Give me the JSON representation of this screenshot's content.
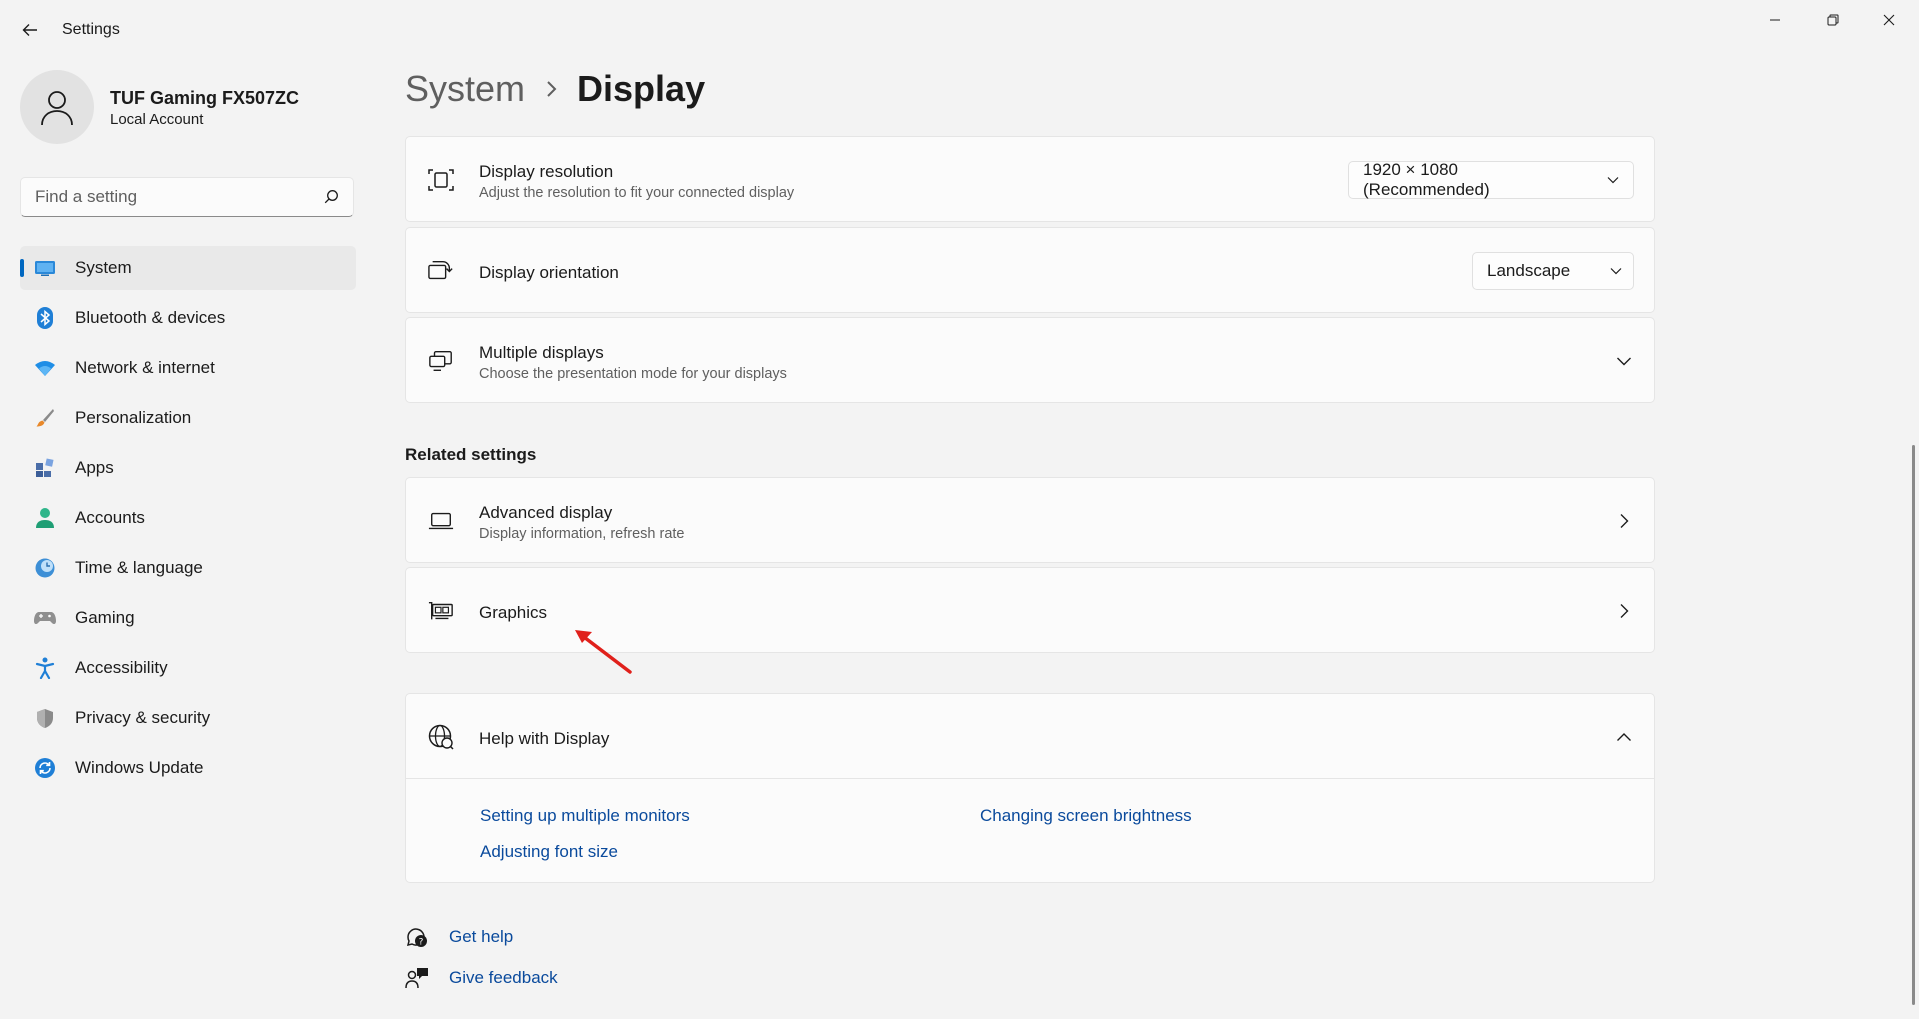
{
  "window": {
    "title": "Settings",
    "controls": [
      "minimize-icon",
      "restore-icon",
      "close-icon"
    ]
  },
  "profile": {
    "name": "TUF Gaming FX507ZC",
    "account_type": "Local Account"
  },
  "search": {
    "placeholder": "Find a setting"
  },
  "sidebar": {
    "items": [
      {
        "label": "System",
        "icon": "system-icon",
        "active": true
      },
      {
        "label": "Bluetooth & devices",
        "icon": "bluetooth-icon"
      },
      {
        "label": "Network & internet",
        "icon": "wifi-icon"
      },
      {
        "label": "Personalization",
        "icon": "brush-icon"
      },
      {
        "label": "Apps",
        "icon": "apps-icon"
      },
      {
        "label": "Accounts",
        "icon": "accounts-icon"
      },
      {
        "label": "Time & language",
        "icon": "globe-clock-icon"
      },
      {
        "label": "Gaming",
        "icon": "gamepad-icon"
      },
      {
        "label": "Accessibility",
        "icon": "accessibility-icon"
      },
      {
        "label": "Privacy & security",
        "icon": "shield-icon"
      },
      {
        "label": "Windows Update",
        "icon": "update-icon"
      }
    ]
  },
  "breadcrumb": {
    "parent": "System",
    "current": "Display"
  },
  "display_settings": {
    "resolution": {
      "title": "Display resolution",
      "subtitle": "Adjust the resolution to fit your connected display",
      "value": "1920 × 1080 (Recommended)"
    },
    "orientation": {
      "title": "Display orientation",
      "value": "Landscape"
    },
    "multiple": {
      "title": "Multiple displays",
      "subtitle": "Choose the presentation mode for your displays"
    }
  },
  "related": {
    "heading": "Related settings",
    "advanced": {
      "title": "Advanced display",
      "subtitle": "Display information, refresh rate"
    },
    "graphics": {
      "title": "Graphics"
    }
  },
  "help": {
    "title": "Help with Display",
    "links": [
      "Setting up multiple monitors",
      "Changing screen brightness",
      "Adjusting font size"
    ]
  },
  "footer": {
    "get_help": "Get help",
    "give_feedback": "Give feedback"
  },
  "colors": {
    "accent": "#0067c0",
    "link": "#0a4a9c",
    "annotation_arrow": "#e0201b"
  }
}
